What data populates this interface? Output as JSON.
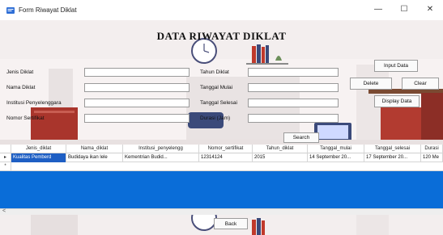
{
  "window": {
    "title": "Form Riwayat Diklat",
    "minimize": "—",
    "maximize": "☐",
    "close": "✕"
  },
  "heading": "DATA RIWAYAT DIKLAT",
  "form": {
    "left_labels": [
      "Jenis Diklat",
      "Nama Diklat",
      "Institusi Penyelenggara",
      "Nomor Sertifikat"
    ],
    "right_labels": [
      "Tahun Diklat",
      "Tanggal Mulai",
      "Tanggal Selesai",
      "Durasi (Jam)"
    ],
    "values": {
      "jenis": "",
      "nama": "",
      "institusi": "",
      "nomor": "",
      "tahun": "",
      "mulai": "",
      "selesai": "",
      "durasi": ""
    }
  },
  "buttons": {
    "input": "Input Data",
    "delete": "Delete",
    "clear": "Clear",
    "display": "Display Data",
    "search": "Search",
    "back": "Back"
  },
  "grid": {
    "columns": [
      "Jenis_diklat",
      "Nama_diklat",
      "Institusi_penyelengg",
      "Nomor_sertifikat",
      "Tahun_diklat",
      "Tanggal_mulai",
      "Tanggal_selesai",
      "Durasi"
    ],
    "rows": [
      {
        "marker": "▸",
        "cells": [
          "Kualitas Pemberd",
          "Budidaya ikan lele",
          "Kementrian Budid...",
          "12314124",
          "2015",
          "14 September 20...",
          "17 September 20...",
          "120 Me"
        ]
      }
    ],
    "new_row_marker": "*",
    "scroll_left": "<"
  },
  "colors": {
    "grid_background": "#0a6dd8",
    "selection": "#1e5fc4",
    "form_background": "#f4f1f1"
  }
}
